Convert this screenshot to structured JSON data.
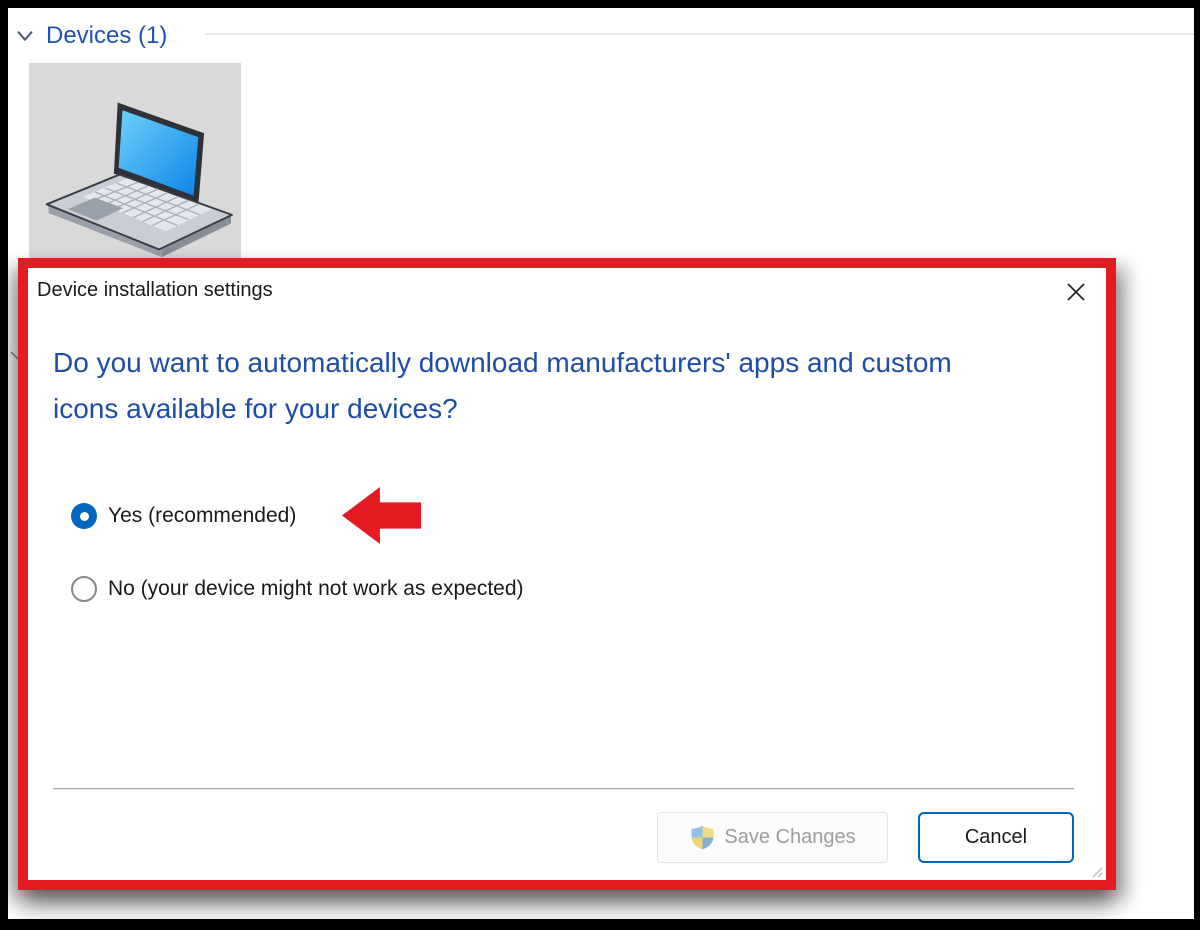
{
  "background": {
    "section": {
      "title": "Devices (1)"
    },
    "device_tile": {
      "device": "laptop"
    }
  },
  "dialog": {
    "title": "Device installation settings",
    "question": "Do you want to automatically download manufacturers' apps and custom icons available for your devices?",
    "options": [
      {
        "label": "Yes (recommended)",
        "selected": true
      },
      {
        "label": "No (your device might not work as expected)",
        "selected": false
      }
    ],
    "buttons": {
      "save": "Save Changes",
      "cancel": "Cancel"
    }
  },
  "annotations": {
    "highlight_border_color": "#e31b22",
    "arrow_color": "#e31b22",
    "arrow_points_to": "Yes (recommended)"
  },
  "colors": {
    "accent_blue": "#0067c0",
    "question_text_blue": "#1d4da6",
    "section_header_blue": "#2151b5",
    "tile_background": "#d9d9d9"
  }
}
